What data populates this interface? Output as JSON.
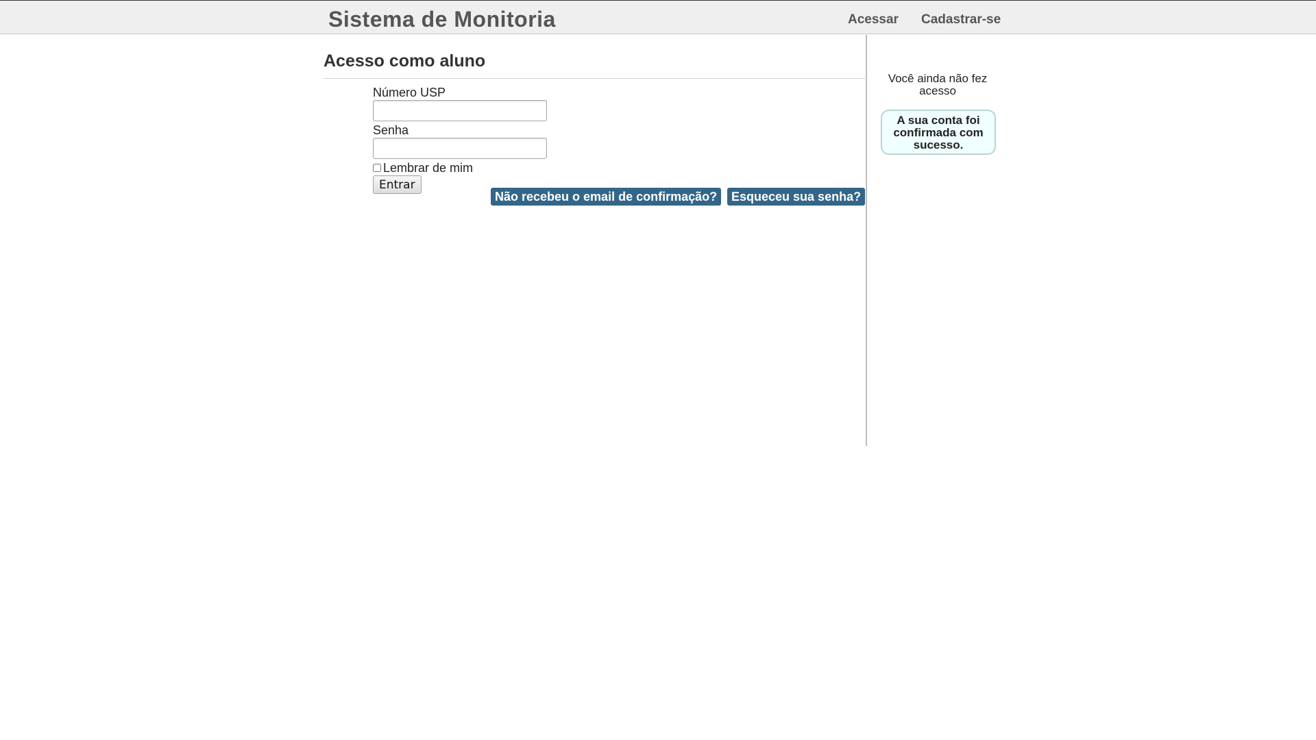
{
  "header": {
    "brand": "Sistema de Monitoria",
    "nav": {
      "login": "Acessar",
      "signup": "Cadastrar-se"
    }
  },
  "main": {
    "title": "Acesso como aluno",
    "form": {
      "usp_label": "Número USP",
      "usp_value": "",
      "password_label": "Senha",
      "password_value": "",
      "remember_label": "Lembrar de mim",
      "remember_checked": false,
      "submit_label": "Entrar"
    },
    "links": {
      "resend_confirmation": "Não recebeu o email de confirmação?",
      "forgot_password": "Esqueceu sua senha?"
    }
  },
  "sidebar": {
    "status": "Você ainda não fez acesso",
    "notice": "A sua conta foi confirmada com sucesso."
  },
  "colors": {
    "topbar_bg": "#efefef",
    "link_button_bg": "#336688",
    "notice_bg": "#f0ffff",
    "notice_border": "#b9d4d4"
  }
}
